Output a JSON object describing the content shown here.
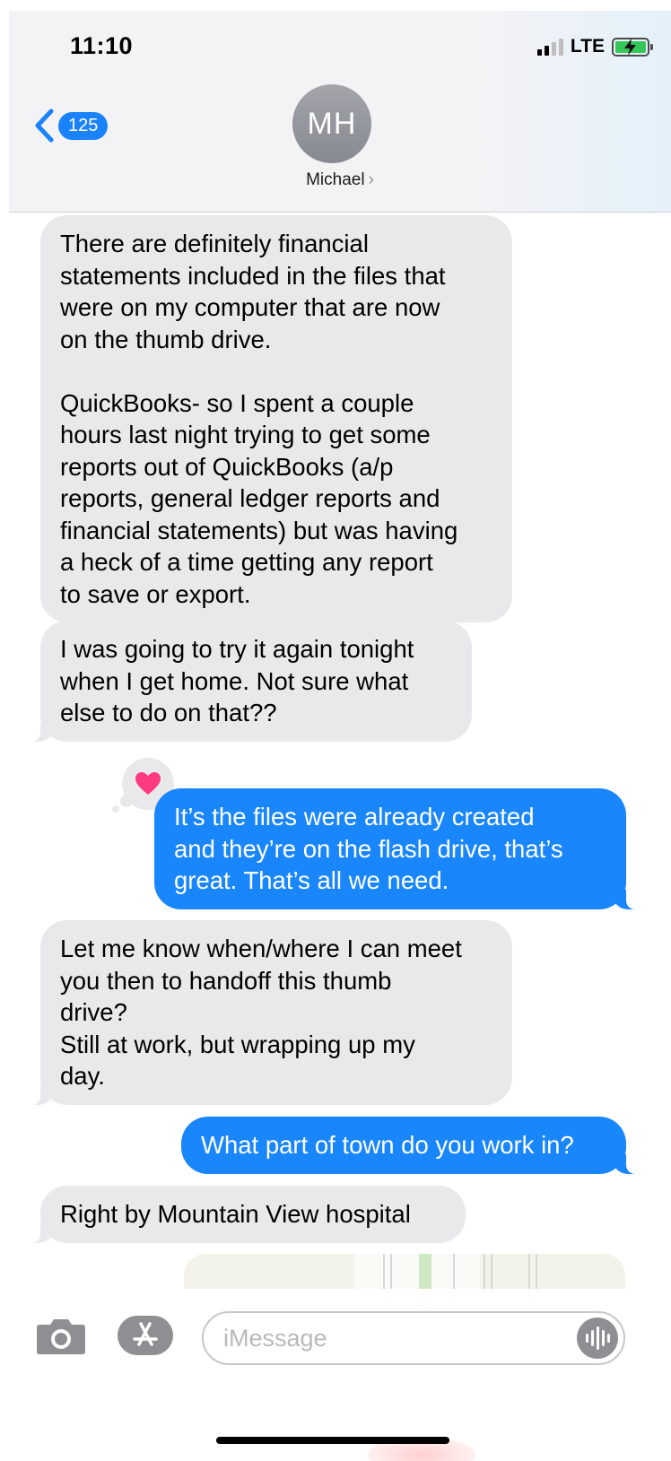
{
  "status_bar": {
    "time": "11:10",
    "network": "LTE"
  },
  "header": {
    "back_count": "125",
    "avatar_initials": "MH",
    "contact_name": "Michael",
    "chevron": "›"
  },
  "messages": [
    {
      "direction": "incoming",
      "lines": [
        "There are definitely financial",
        "statements included in the files that",
        "were on my computer that are now",
        "on the thumb drive.",
        "",
        "QuickBooks- so I spent a couple",
        "hours last night trying to get some",
        "reports out of QuickBooks (a/p",
        "reports, general ledger reports and",
        "financial statements) but was having",
        "a heck of a time getting any report",
        "to save or export."
      ]
    },
    {
      "direction": "incoming",
      "lines": [
        "I was going to try it again tonight",
        "when I get home.  Not sure what",
        "else to do on that??"
      ]
    },
    {
      "direction": "outgoing",
      "reaction": "heart-icon",
      "lines": [
        "It’s the files were already created",
        "and they’re on the flash drive, that’s",
        "great. That’s all we need."
      ]
    },
    {
      "direction": "incoming",
      "lines": [
        "Let me know when/where I can meet",
        "you then to handoff this thumb",
        "drive?",
        "Still at work, but wrapping up my",
        "day."
      ]
    },
    {
      "direction": "outgoing",
      "lines": [
        "What part of town do you work in?"
      ]
    },
    {
      "direction": "incoming",
      "lines": [
        "Right by Mountain View hospital"
      ]
    }
  ],
  "composer": {
    "placeholder": "iMessage"
  },
  "colors": {
    "outgoing_bubble": "#1a86fb",
    "incoming_bubble": "#e9e9eb",
    "badge": "#1a82fb",
    "reaction_heart": "#ff3b7f",
    "battery": "#35c759"
  },
  "icons": [
    "chevron-left-icon",
    "signal-icon",
    "battery-charging-icon",
    "heart-icon",
    "camera-icon",
    "app-store-icon",
    "audio-waveform-icon"
  ]
}
